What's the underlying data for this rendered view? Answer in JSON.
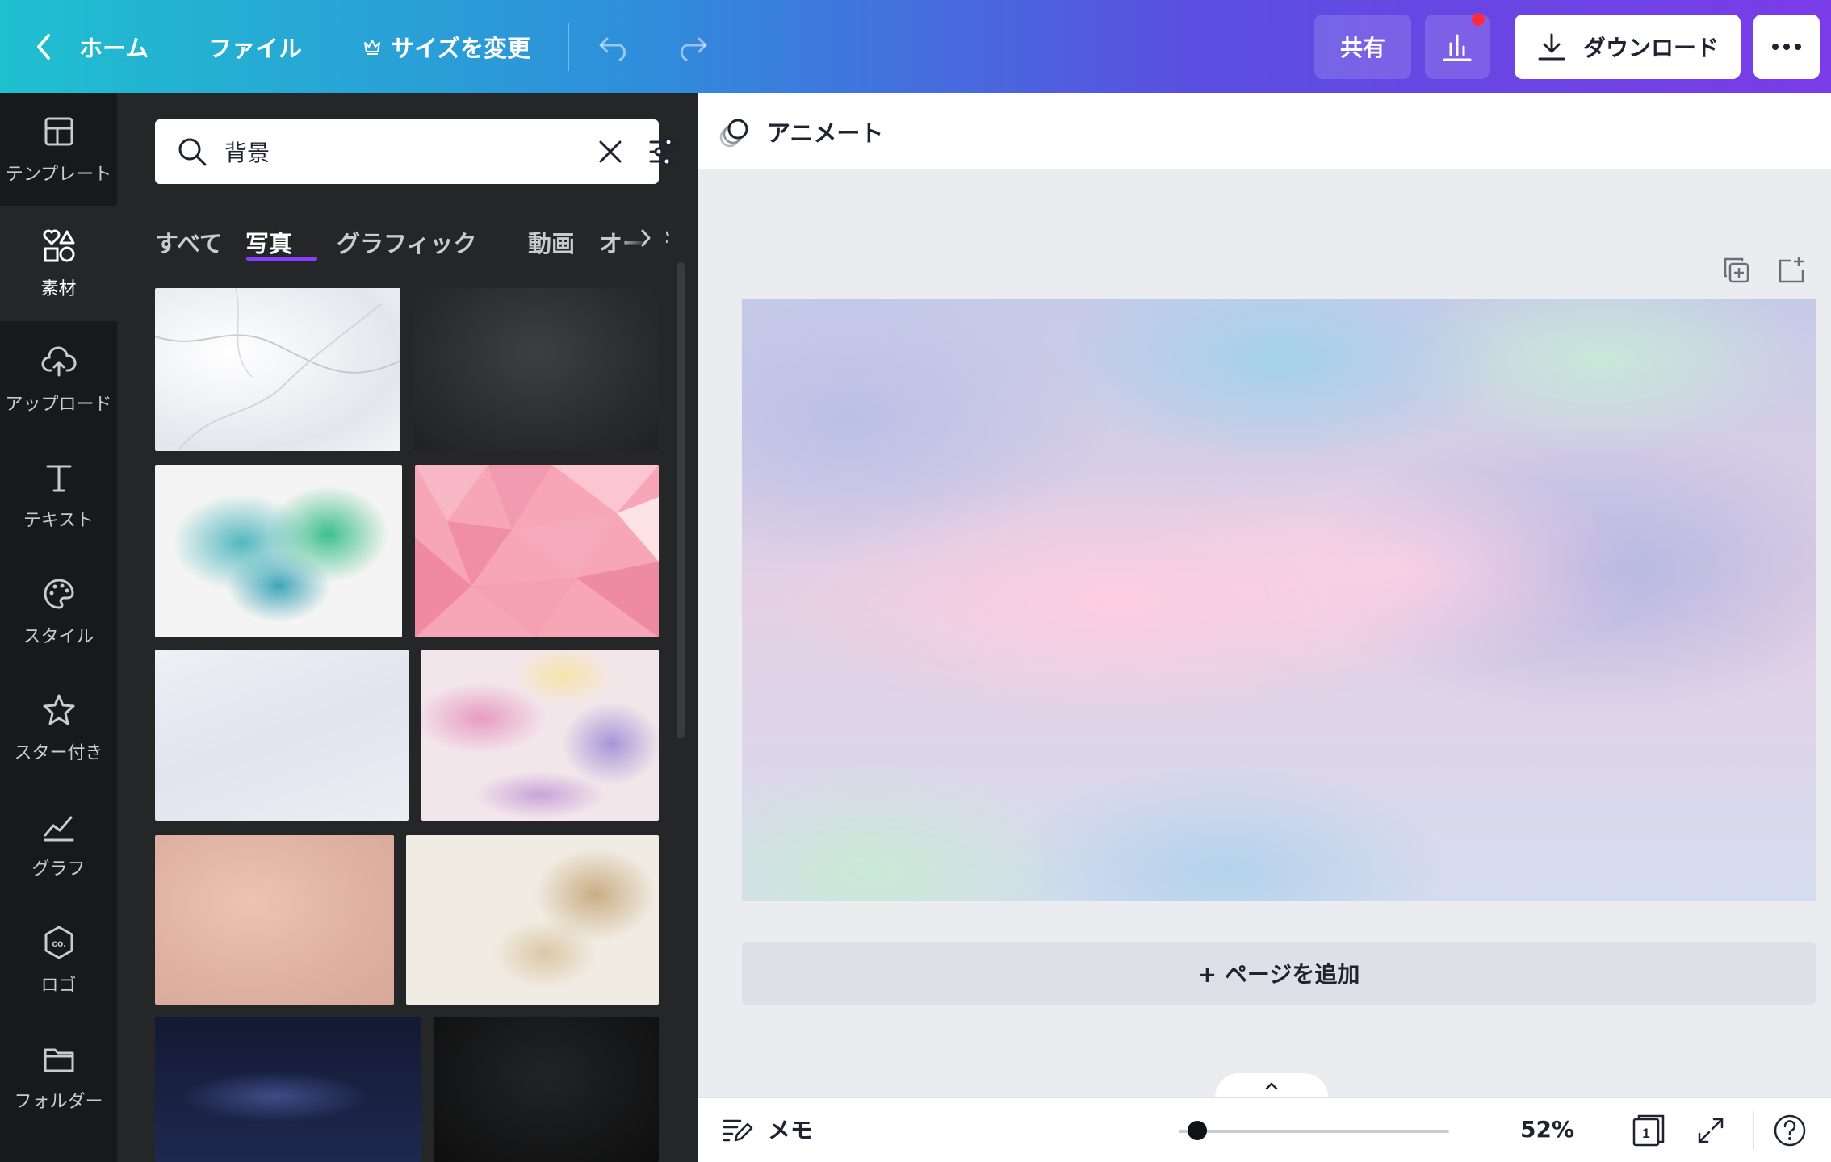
{
  "topbar": {
    "home_label": "ホーム",
    "file_label": "ファイル",
    "resize_label": "サイズを変更",
    "share_label": "共有",
    "download_label": "ダウンロード",
    "icons": [
      "chevron-left-icon",
      "crown-icon",
      "undo-icon",
      "redo-icon",
      "analytics-icon",
      "download-icon",
      "more-icon"
    ],
    "notification_color": "#ff2a3d"
  },
  "rail": {
    "items": [
      {
        "label": "テンプレート",
        "icon": "template-icon"
      },
      {
        "label": "素材",
        "icon": "elements-icon"
      },
      {
        "label": "アップロード",
        "icon": "upload-cloud-icon"
      },
      {
        "label": "テキスト",
        "icon": "text-icon"
      },
      {
        "label": "スタイル",
        "icon": "palette-icon"
      },
      {
        "label": "スター付き",
        "icon": "star-icon"
      },
      {
        "label": "グラフ",
        "icon": "chart-icon"
      },
      {
        "label": "ロゴ",
        "icon": "logo-icon"
      },
      {
        "label": "フォルダー",
        "icon": "folder-icon"
      }
    ],
    "active_index": 1
  },
  "panel": {
    "search": {
      "value": "背景"
    },
    "tabs": [
      "すべて",
      "写真",
      "グラフィック",
      "動画",
      "オーデ"
    ],
    "active_tab": "写真"
  },
  "editor": {
    "animate_label": "アニメート",
    "add_page_label": "+ ページを追加",
    "memo_label": "メモ",
    "zoom": "52%",
    "page_count": "1",
    "zoom_fraction": 0.06
  }
}
